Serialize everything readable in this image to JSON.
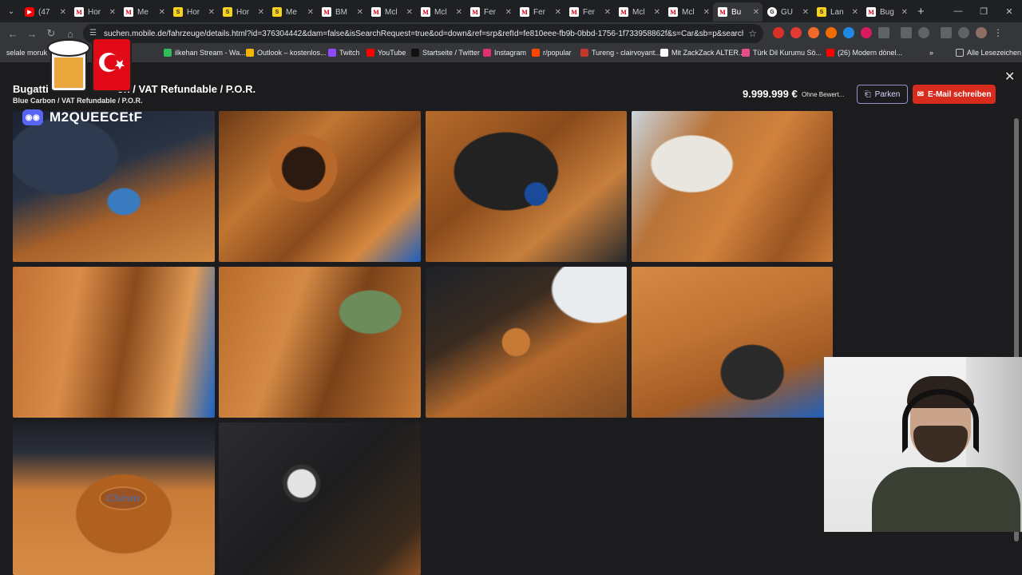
{
  "tabs": [
    {
      "label": "(47",
      "icon": "youtube-icon",
      "type": "yt"
    },
    {
      "label": "Hor",
      "icon": "mobile-de-icon",
      "type": "m"
    },
    {
      "label": "Me",
      "icon": "mobile-de-icon",
      "type": "m"
    },
    {
      "label": "Hor",
      "icon": "s-icon",
      "type": "s"
    },
    {
      "label": "Hor",
      "icon": "s-icon",
      "type": "s"
    },
    {
      "label": "Me",
      "icon": "s-icon",
      "type": "s"
    },
    {
      "label": "BM",
      "icon": "mobile-de-icon",
      "type": "m"
    },
    {
      "label": "Mcl",
      "icon": "mobile-de-icon",
      "type": "m"
    },
    {
      "label": "Mcl",
      "icon": "mobile-de-icon",
      "type": "m"
    },
    {
      "label": "Fer",
      "icon": "mobile-de-icon",
      "type": "m"
    },
    {
      "label": "Fer",
      "icon": "mobile-de-icon",
      "type": "m"
    },
    {
      "label": "Fer",
      "icon": "mobile-de-icon",
      "type": "m"
    },
    {
      "label": "Mcl",
      "icon": "mobile-de-icon",
      "type": "m"
    },
    {
      "label": "Mcl",
      "icon": "mobile-de-icon",
      "type": "m"
    },
    {
      "label": "Bu",
      "icon": "mobile-de-icon",
      "type": "m",
      "active": true
    },
    {
      "label": "GU",
      "icon": "g-icon",
      "type": "g"
    },
    {
      "label": "Lan",
      "icon": "s-icon",
      "type": "s"
    },
    {
      "label": "Bug",
      "icon": "mobile-de-icon",
      "type": "m"
    }
  ],
  "toolbar": {
    "url": "suchen.mobile.de/fahrzeuge/details.html?id=376304442&dam=false&isSearchRequest=true&od=down&ref=srp&refId=fe810eee-fb9b-0bbd-1756-1f733958862f&s=Car&sb=p&searchId=fe81..."
  },
  "bookmarks": [
    {
      "label": "selale moruk",
      "color": "#35363a"
    },
    {
      "label": "ilkehan Stream - Wa...",
      "color": "#2ebd59"
    },
    {
      "label": "Outlook – kostenlos...",
      "color": "#f4b400"
    },
    {
      "label": "Twitch",
      "color": "#9146ff"
    },
    {
      "label": "YouTube",
      "color": "#ff0000"
    },
    {
      "label": "Startseite / Twitter",
      "color": "#111111"
    },
    {
      "label": "Instagram",
      "color": "#e1306c"
    },
    {
      "label": "r/popular",
      "color": "#ff4500"
    },
    {
      "label": "Tureng - clairvoyant...",
      "color": "#c0392b"
    },
    {
      "label": "Mit ZackZack ALTER...",
      "color": "#ffffff"
    },
    {
      "label": "Türk Dil Kurumu Sö...",
      "color": "#e84d8a"
    },
    {
      "label": "(26) Modern dönel...",
      "color": "#ff0000"
    }
  ],
  "bookmarks_more": "»",
  "bookmarks_all": "Alle Lesezeichen",
  "listing": {
    "title": "Bugatti",
    "title_rest": "on / VAT Refundable / P.O.R.",
    "subtitle": "Blue Carbon / VAT Refundable / P.O.R.",
    "price": "9.999.999 €",
    "rating": "Ohne Bewert...",
    "park_label": "Parken",
    "mail_label": "E-Mail schreiben",
    "badge_text": "Chiron"
  },
  "overlay": {
    "discord_name": "M2QUEECEtF"
  },
  "colors": {
    "accent": "#d62b1d",
    "park_border": "#9b8ec9",
    "page_bg": "#1c1c1e"
  }
}
